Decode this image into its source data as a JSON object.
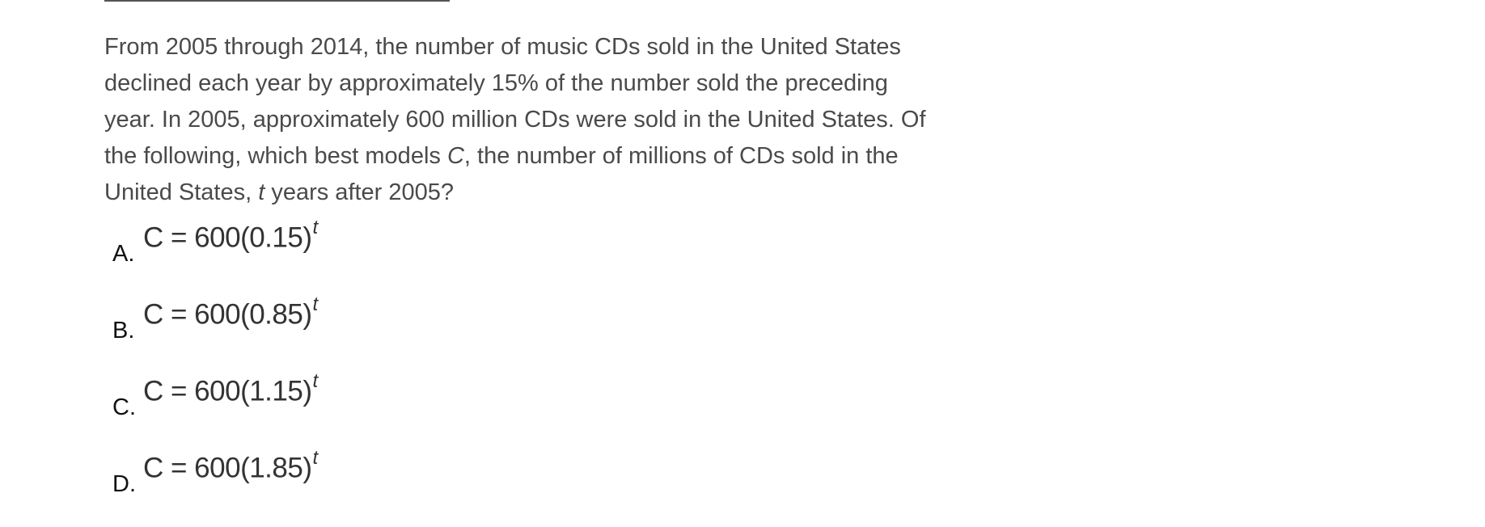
{
  "question": {
    "part1": "From 2005 through 2014, the number of music CDs sold in the United States declined each year by approximately 15% of the number sold the preceding year. In 2005, approximately 600 million CDs were sold in the United States. Of the following, which best models ",
    "var_c": "C",
    "part2": ", the number of millions of CDs sold in the United States, ",
    "var_t": "t",
    "part3": " years after 2005?"
  },
  "choices": [
    {
      "letter": "A.",
      "lhs": "C",
      "eq": " = 600(0.15)",
      "exp": "t"
    },
    {
      "letter": "B.",
      "lhs": "C",
      "eq": " = 600(0.85)",
      "exp": "t"
    },
    {
      "letter": "C.",
      "lhs": "C",
      "eq": " = 600(1.15)",
      "exp": "t"
    },
    {
      "letter": "D.",
      "lhs": "C",
      "eq": " = 600(1.85)",
      "exp": "t"
    }
  ]
}
